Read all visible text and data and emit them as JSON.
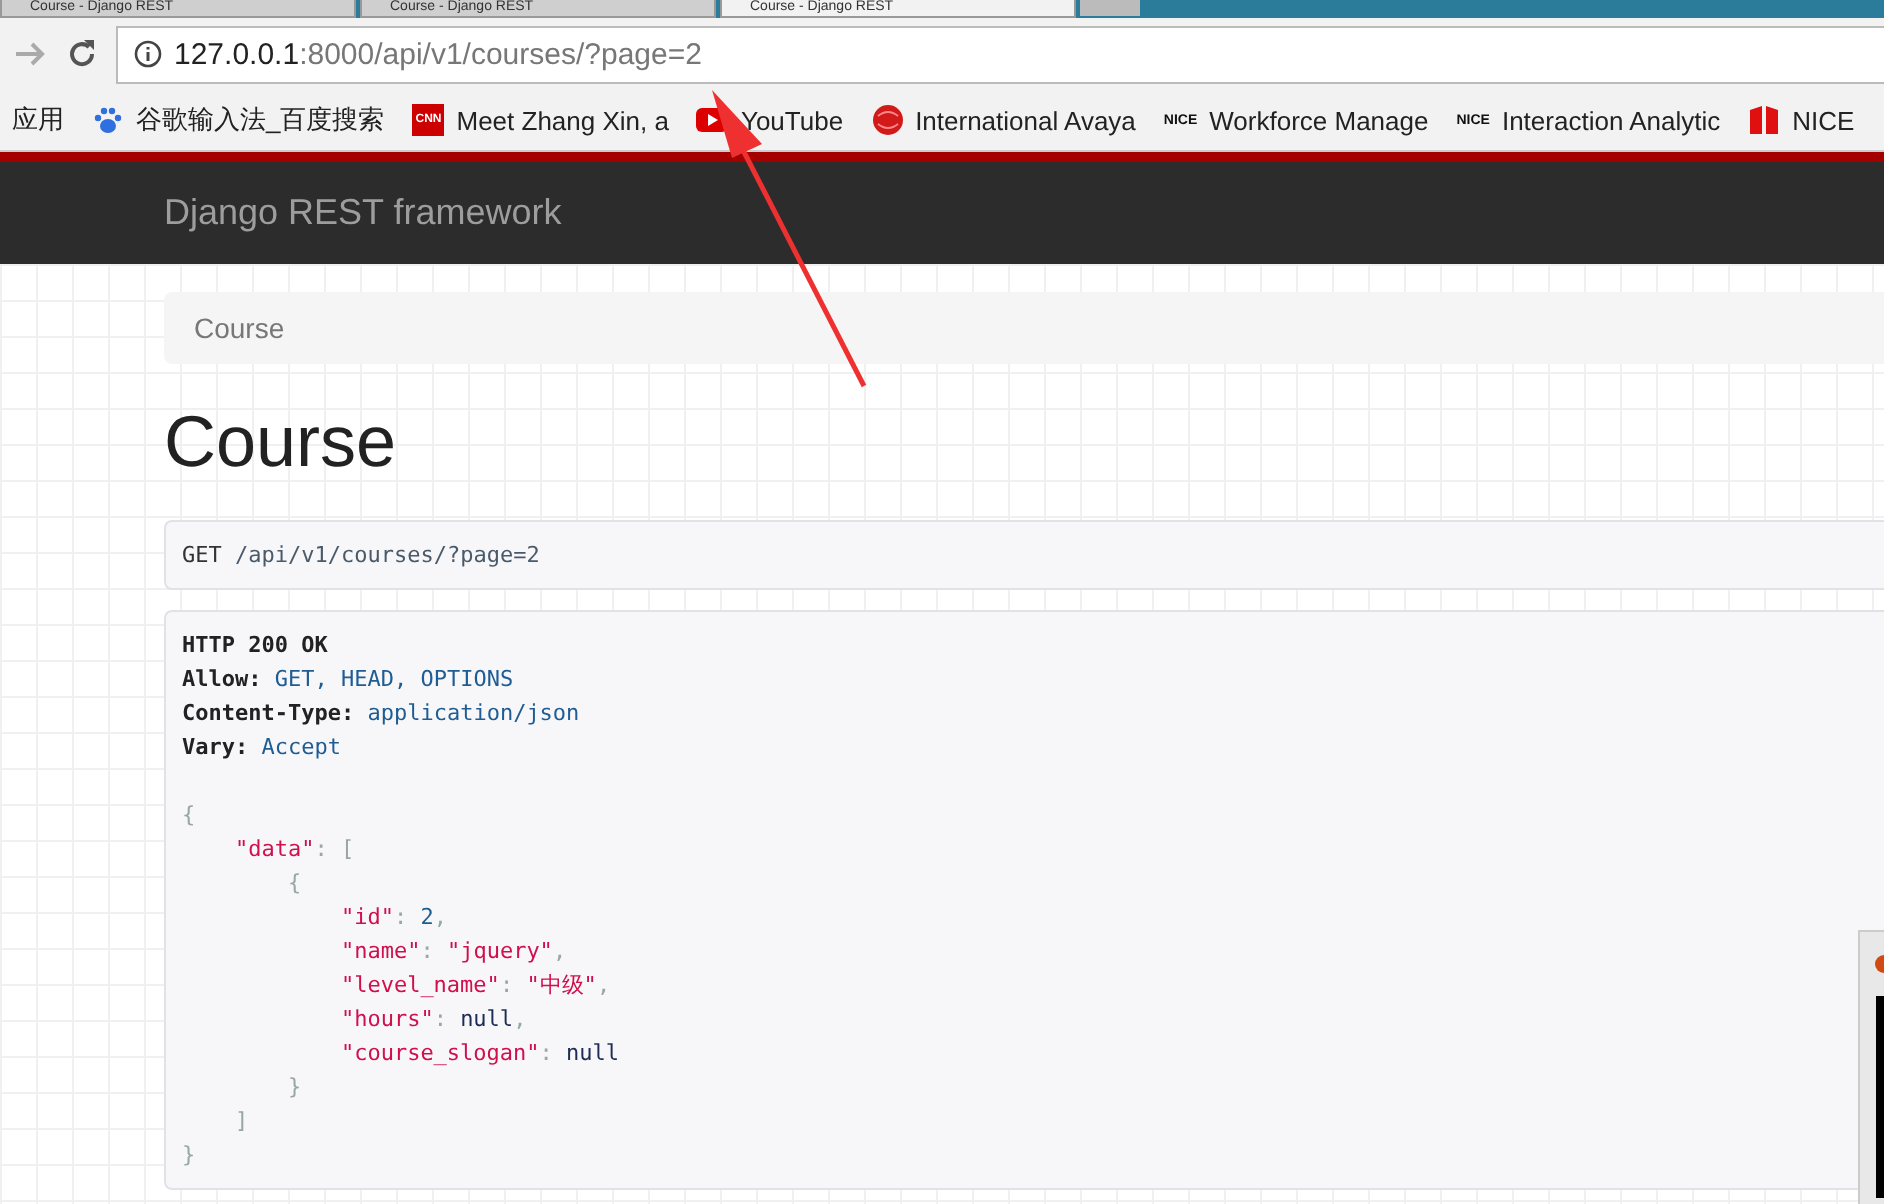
{
  "browser": {
    "tabs": [
      {
        "title": "Course - Django REST",
        "selected": false
      },
      {
        "title": "Course - Django REST",
        "selected": false
      },
      {
        "title": "Course - Django REST",
        "selected": true
      }
    ],
    "address": {
      "host": "127.0.0.1",
      "path": ":8000/api/v1/courses/?page=2"
    },
    "bookmarks": [
      {
        "label": "应用",
        "kind": "none"
      },
      {
        "label": "谷歌输入法_百度搜索",
        "kind": "paw"
      },
      {
        "label": "Meet Zhang Xin, a",
        "kind": "cnn",
        "logo_text": "CNN"
      },
      {
        "label": "YouTube",
        "kind": "youtube"
      },
      {
        "label": "International Avaya",
        "kind": "globe"
      },
      {
        "label": "Workforce Manage",
        "kind": "nice",
        "logo_text": "NICE"
      },
      {
        "label": "Interaction Analytic",
        "kind": "nice",
        "logo_text": "NICE"
      },
      {
        "label": "NICE",
        "kind": "flag"
      }
    ]
  },
  "navbar": {
    "brand": "Django REST framework"
  },
  "breadcrumb": [
    "Course"
  ],
  "heading": "Course",
  "request": {
    "method": "GET",
    "path": "/api/v1/courses/?page=2"
  },
  "response": {
    "status": "HTTP 200 OK",
    "headers": [
      {
        "name": "Allow:",
        "value": "GET, HEAD, OPTIONS"
      },
      {
        "name": "Content-Type:",
        "value": "application/json"
      },
      {
        "name": "Vary:",
        "value": "Accept"
      }
    ],
    "body": [
      {
        "tokens": [
          {
            "kind": "punct",
            "text": "{"
          }
        ],
        "children": [
          {
            "tokens": [
              {
                "kind": "key",
                "text": "\"data\""
              },
              {
                "kind": "punct",
                "text": ": ["
              }
            ],
            "children": [
              {
                "tokens": [
                  {
                    "kind": "punct",
                    "text": "{"
                  }
                ],
                "children": [
                  {
                    "tokens": [
                      {
                        "kind": "key",
                        "text": "\"id\""
                      },
                      {
                        "kind": "punct",
                        "text": ": "
                      },
                      {
                        "kind": "number",
                        "text": "2"
                      },
                      {
                        "kind": "punct",
                        "text": ","
                      }
                    ]
                  },
                  {
                    "tokens": [
                      {
                        "kind": "key",
                        "text": "\"name\""
                      },
                      {
                        "kind": "punct",
                        "text": ": "
                      },
                      {
                        "kind": "string",
                        "text": "\"jquery\""
                      },
                      {
                        "kind": "punct",
                        "text": ","
                      }
                    ]
                  },
                  {
                    "tokens": [
                      {
                        "kind": "key",
                        "text": "\"level_name\""
                      },
                      {
                        "kind": "punct",
                        "text": ": "
                      },
                      {
                        "kind": "string",
                        "text": "\"中级\""
                      },
                      {
                        "kind": "punct",
                        "text": ","
                      }
                    ]
                  },
                  {
                    "tokens": [
                      {
                        "kind": "key",
                        "text": "\"hours\""
                      },
                      {
                        "kind": "punct",
                        "text": ": "
                      },
                      {
                        "kind": "null",
                        "text": "null"
                      },
                      {
                        "kind": "punct",
                        "text": ","
                      }
                    ]
                  },
                  {
                    "tokens": [
                      {
                        "kind": "key",
                        "text": "\"course_slogan\""
                      },
                      {
                        "kind": "punct",
                        "text": ": "
                      },
                      {
                        "kind": "null",
                        "text": "null"
                      }
                    ]
                  }
                ]
              },
              {
                "tokens": [
                  {
                    "kind": "punct",
                    "text": "}"
                  }
                ]
              }
            ]
          },
          {
            "tokens": [
              {
                "kind": "punct",
                "text": "]"
              }
            ]
          }
        ]
      },
      {
        "tokens": [
          {
            "kind": "punct",
            "text": "}"
          }
        ]
      }
    ]
  }
}
